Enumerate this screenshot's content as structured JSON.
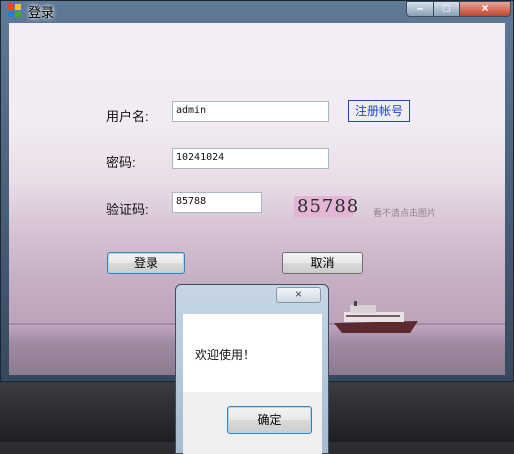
{
  "window": {
    "title": "登录"
  },
  "titlebar": {
    "minimize": "–",
    "maximize": "□",
    "close": "×"
  },
  "form": {
    "username_label": "用户名:",
    "username_value": "admin",
    "register_link": "注册帐号",
    "password_label": "密码:",
    "password_value": "10241024",
    "captcha_label": "验证码:",
    "captcha_value": "85788",
    "captcha_image_text": "85788",
    "captcha_hint": "看不清点击图片",
    "login_button": "登录",
    "cancel_button": "取消"
  },
  "dialog": {
    "close": "×",
    "message": "欢迎使用！",
    "ok_button": "确定"
  }
}
